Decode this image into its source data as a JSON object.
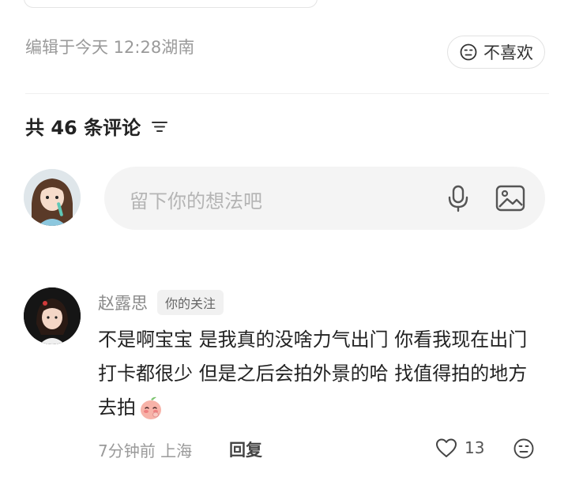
{
  "post": {
    "edited_text": "编辑于今天 12:28湖南",
    "dislike_label": "不喜欢"
  },
  "comments_section": {
    "title": "共 46 条评论",
    "input_placeholder": "留下你的想法吧"
  },
  "comment": {
    "author": "赵露思",
    "badge": "你的关注",
    "text": "不是啊宝宝 是我真的没啥力气出门 你看我现在出门打卡都很少 但是之后会拍外景的哈 找值得拍的地方去拍",
    "emoji": "shy-peach-face-icon",
    "time_location": "7分钟前 上海",
    "reply_label": "回复",
    "likes": "13"
  },
  "colors": {
    "text_primary": "#222222",
    "text_secondary": "#9a9a9a",
    "input_bg": "#f4f4f4",
    "badge_bg": "#f1f1f1",
    "emoji_pink": "#f5a3a3"
  }
}
